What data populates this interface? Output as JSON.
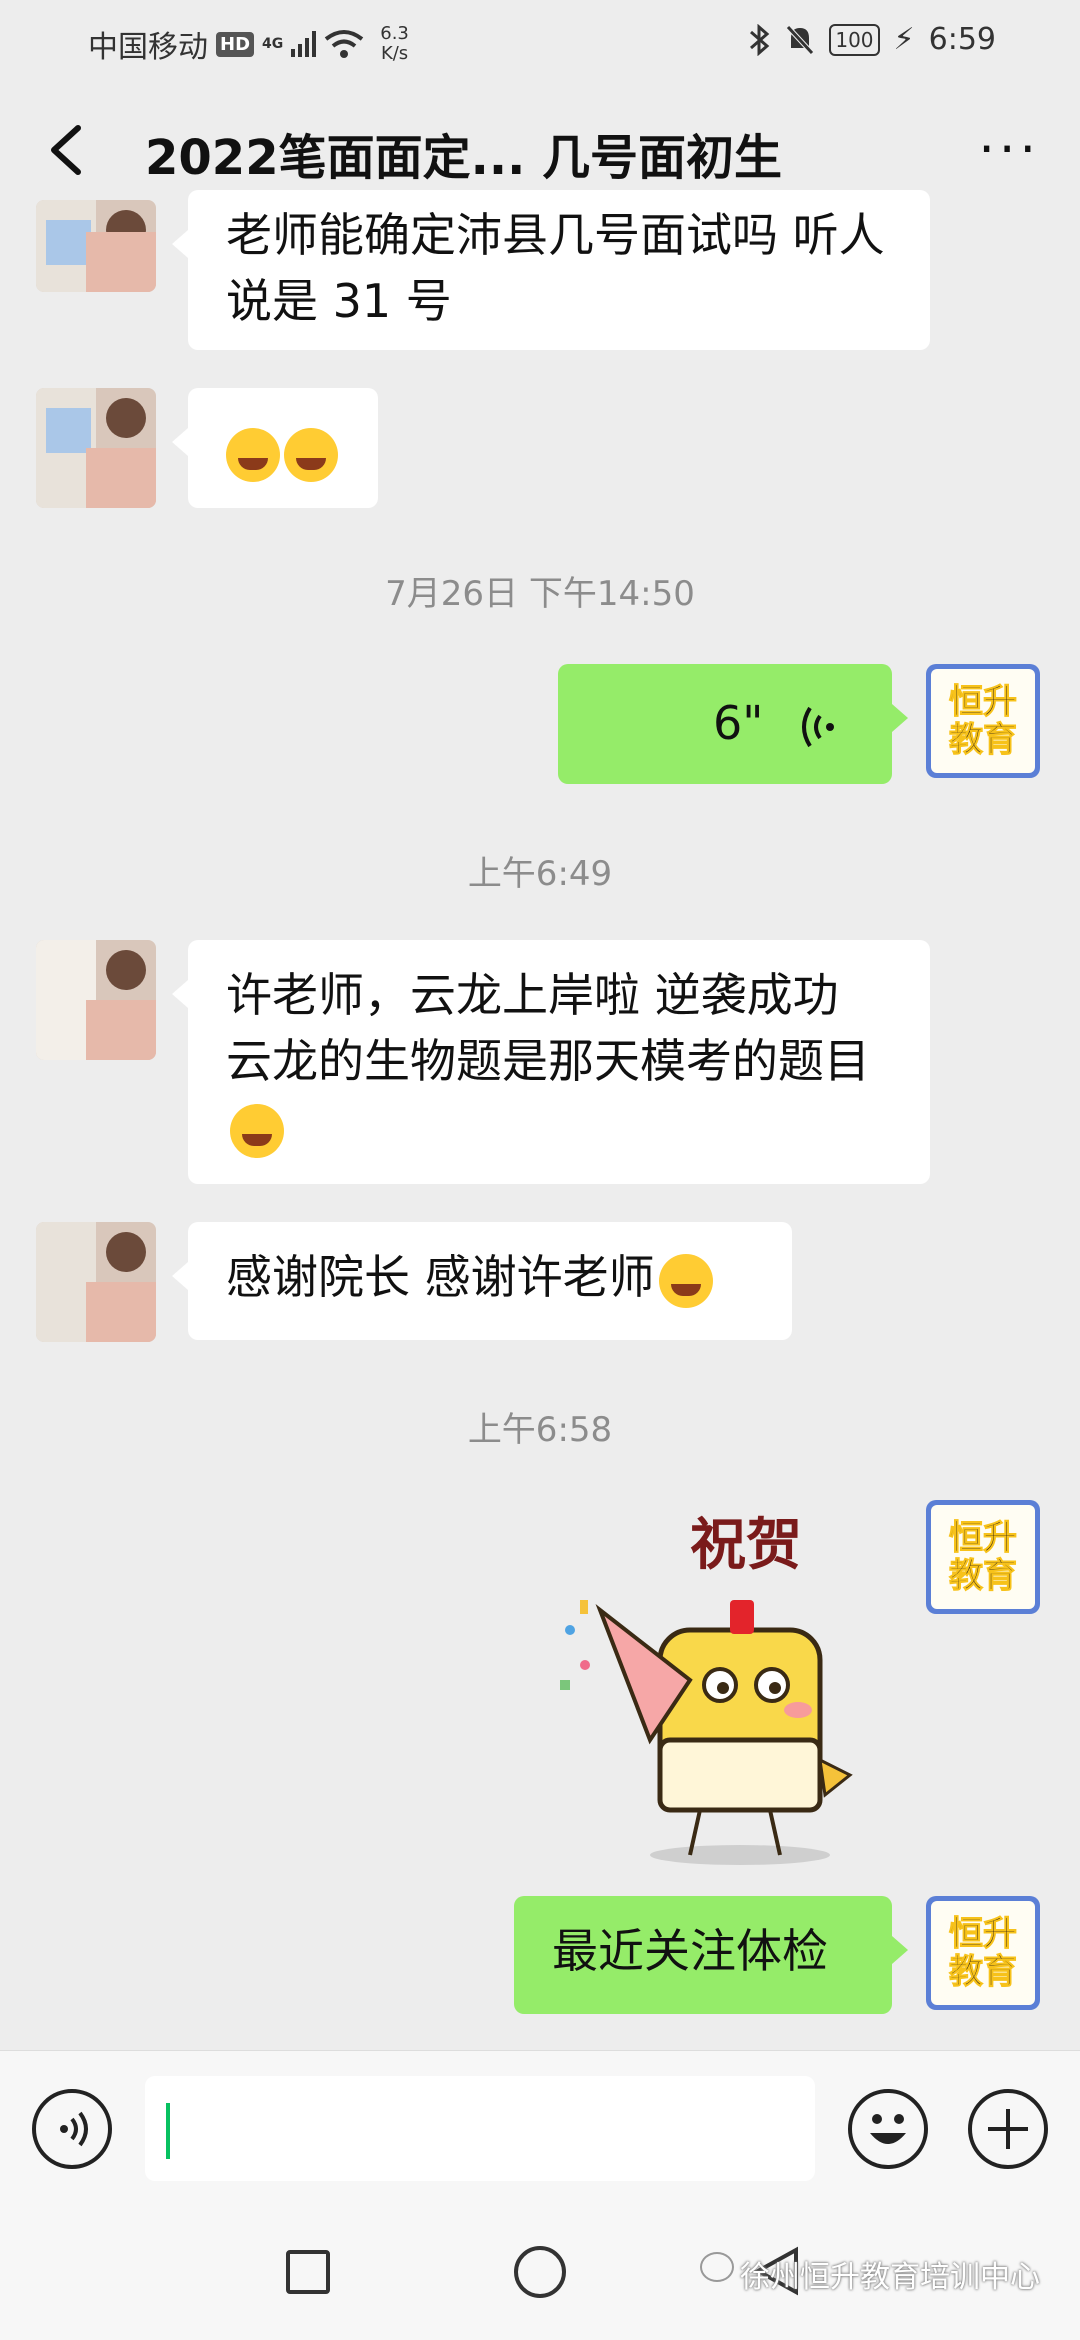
{
  "status_bar": {
    "carrier": "中国移动",
    "hd": "HD",
    "network": "4G",
    "speed_value": "6.3",
    "speed_unit": "K/s",
    "battery": "100",
    "time": "6:59"
  },
  "header": {
    "title": "2022笔面面定... 几号面初生",
    "more_label": "···"
  },
  "messages": {
    "m1_text": "老师能确定沛县几号面试吗 听人说是 31 号",
    "ts1": "7月26日 下午14:50",
    "voice_duration": "6\"",
    "ts2": "上午6:49",
    "m4_text": "许老师，云龙上岸啦 逆袭成功 云龙的生物题是那天模考的题目",
    "m5_text": "感谢院长 感谢许老师",
    "ts3": "上午6:58",
    "sticker_text": "祝贺",
    "m7_text": "最近关注体检"
  },
  "my_avatar": {
    "line1": "恒升",
    "line2": "教育"
  },
  "watermark": "徐州恒升教育培训中心"
}
